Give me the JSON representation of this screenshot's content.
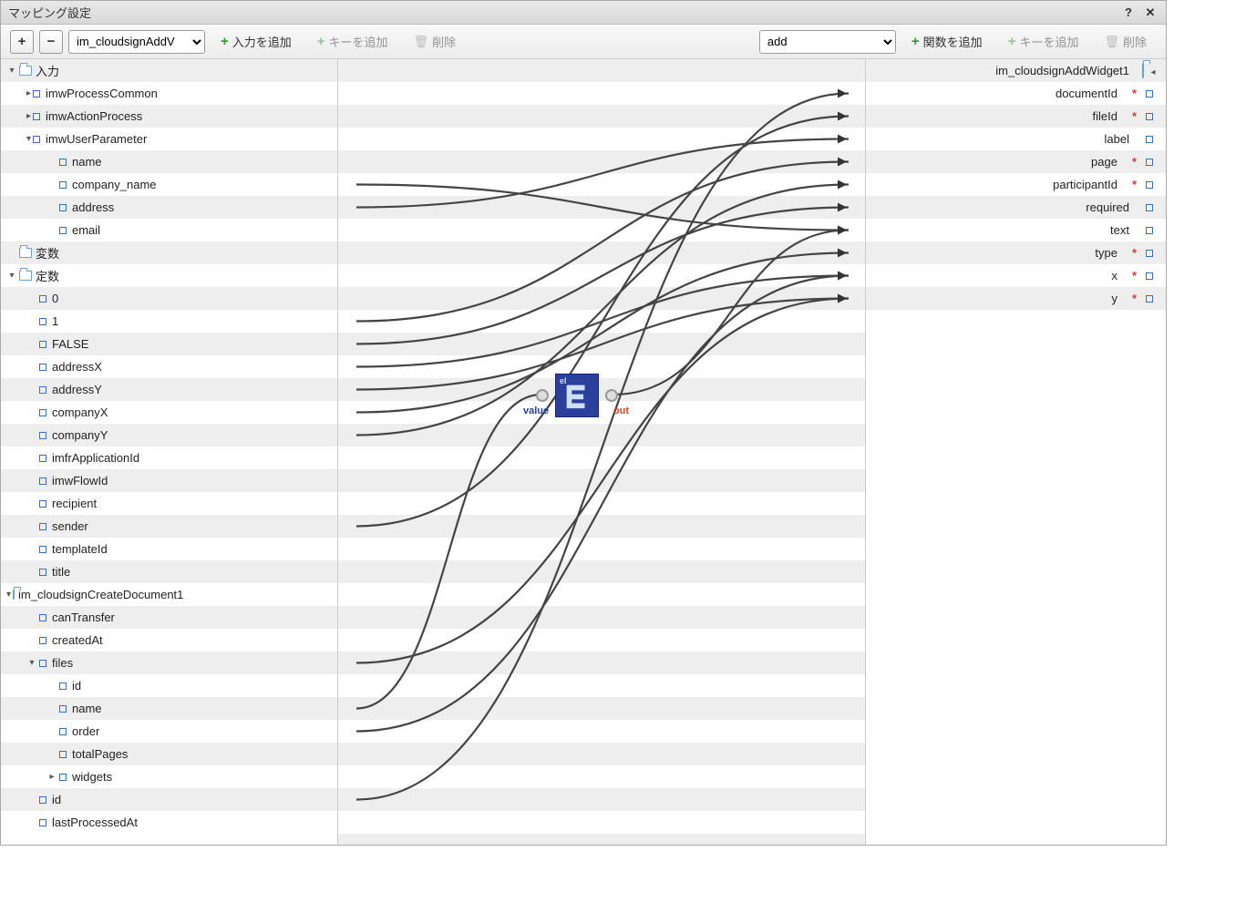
{
  "title": "マッピング設定",
  "toolbar": {
    "left_select": "im_cloudsignAddV",
    "add_input": "入力を追加",
    "add_key_left": "キーを追加",
    "delete_left": "削除",
    "right_select": "add",
    "add_func": "関数を追加",
    "add_key_right": "キーを追加",
    "delete_right": "削除"
  },
  "left_tree": [
    {
      "indent": 0,
      "toggle": "▼",
      "folder": true,
      "label": "入力",
      "type": "<object>"
    },
    {
      "indent": 1,
      "toggle": "▶",
      "sq": true,
      "label": "imwProcessCommon",
      "type": "<object>"
    },
    {
      "indent": 1,
      "toggle": "▶",
      "sq": true,
      "label": "imwActionProcess",
      "type": "<object>"
    },
    {
      "indent": 1,
      "toggle": "▼",
      "sq": true,
      "label": "imwUserParameter",
      "type": "<object>"
    },
    {
      "indent": 2,
      "sq": true,
      "label": "name",
      "type": "<string>"
    },
    {
      "indent": 2,
      "sq": true,
      "label": "company_name",
      "type": "<string>"
    },
    {
      "indent": 2,
      "sq": true,
      "label": "address",
      "type": "<string>"
    },
    {
      "indent": 2,
      "sq": true,
      "label": "email",
      "type": "<string>"
    },
    {
      "indent": 0,
      "folder": true,
      "label": "変数",
      "type": "<object>"
    },
    {
      "indent": 0,
      "toggle": "▼",
      "folder": true,
      "label": "定数",
      "type": "<object>"
    },
    {
      "indent": 1,
      "sq": true,
      "label": "0",
      "type": "<string>"
    },
    {
      "indent": 1,
      "sq": true,
      "label": "1",
      "type": "<string>"
    },
    {
      "indent": 1,
      "sq": true,
      "label": "FALSE",
      "type": "<string>"
    },
    {
      "indent": 1,
      "sq": true,
      "label": "addressX",
      "type": "<string>"
    },
    {
      "indent": 1,
      "sq": true,
      "label": "addressY",
      "type": "<string>"
    },
    {
      "indent": 1,
      "sq": true,
      "label": "companyX",
      "type": "<string>"
    },
    {
      "indent": 1,
      "sq": true,
      "label": "companyY",
      "type": "<string>"
    },
    {
      "indent": 1,
      "sq": true,
      "label": "imfrApplicationId",
      "type": "<string>"
    },
    {
      "indent": 1,
      "sq": true,
      "label": "imwFlowId",
      "type": "<string>"
    },
    {
      "indent": 1,
      "sq": true,
      "label": "recipient",
      "type": "<string>"
    },
    {
      "indent": 1,
      "sq": true,
      "label": "sender",
      "type": "<string>"
    },
    {
      "indent": 1,
      "sq": true,
      "label": "templateId",
      "type": "<string>"
    },
    {
      "indent": 1,
      "sq": true,
      "label": "title",
      "type": "<string>"
    },
    {
      "indent": 0,
      "toggle": "▼",
      "folder": true,
      "label": "im_cloudsignCreateDocument1",
      "type": "<object>"
    },
    {
      "indent": 1,
      "sq": true,
      "label": "canTransfer",
      "type": "<boolean>"
    },
    {
      "indent": 1,
      "sq": true,
      "label": "createdAt",
      "type": "<string>"
    },
    {
      "indent": 1,
      "toggle": "▼",
      "sq": true,
      "label": "files",
      "type": "<object[]>"
    },
    {
      "indent": 2,
      "sq": true,
      "label": "id",
      "type": "<string>"
    },
    {
      "indent": 2,
      "sq": true,
      "label": "name",
      "type": "<string>"
    },
    {
      "indent": 2,
      "sq": true,
      "label": "order",
      "type": "<integer>"
    },
    {
      "indent": 2,
      "sq": true,
      "label": "totalPages",
      "type": "<integer>"
    },
    {
      "indent": 2,
      "toggle": "▶",
      "sq": true,
      "label": "widgets",
      "type": "<object[]>"
    },
    {
      "indent": 1,
      "sq": true,
      "label": "id",
      "type": "<string>"
    },
    {
      "indent": 1,
      "sq": true,
      "label": "lastProcessedAt",
      "type": "<string>"
    }
  ],
  "right_tree": [
    {
      "label": "im_cloudsignAddWidget1",
      "type": "<object>",
      "folder": true,
      "toggle": "◂"
    },
    {
      "label": "documentId",
      "type": "<string>",
      "req": true,
      "sq": true
    },
    {
      "label": "fileId",
      "type": "<string>",
      "req": true,
      "sq": true
    },
    {
      "label": "label",
      "type": "<string>",
      "sq": true
    },
    {
      "label": "page",
      "type": "<integer>",
      "req": true,
      "sq": true
    },
    {
      "label": "participantId",
      "type": "<string>",
      "req": true,
      "sq": true
    },
    {
      "label": "required",
      "type": "<boolean>",
      "sq": true
    },
    {
      "label": "text",
      "type": "<string>",
      "sq": true
    },
    {
      "label": "type",
      "type": "<integer>",
      "req": true,
      "sq": true
    },
    {
      "label": "x",
      "type": "<integer>",
      "req": true,
      "sq": true
    },
    {
      "label": "y",
      "type": "<integer>",
      "req": true,
      "sq": true
    }
  ],
  "func_node": {
    "in_label": "value",
    "in_small": "el",
    "out_label": "out"
  }
}
